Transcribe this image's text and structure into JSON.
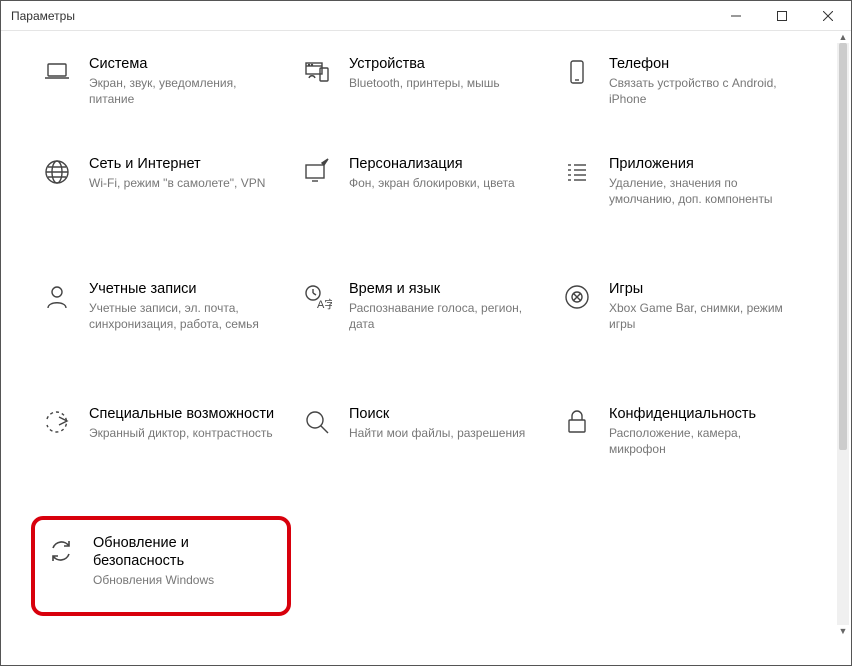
{
  "window": {
    "title": "Параметры"
  },
  "tiles": [
    {
      "title": "Система",
      "subtitle": "Экран, звук, уведомления, питание"
    },
    {
      "title": "Устройства",
      "subtitle": "Bluetooth, принтеры, мышь"
    },
    {
      "title": "Телефон",
      "subtitle": "Связать устройство с Android, iPhone"
    },
    {
      "title": "Сеть и Интернет",
      "subtitle": "Wi-Fi, режим \"в самолете\", VPN"
    },
    {
      "title": "Персонализация",
      "subtitle": "Фон, экран блокировки, цвета"
    },
    {
      "title": "Приложения",
      "subtitle": "Удаление, значения по умолчанию, доп. компоненты"
    },
    {
      "title": "Учетные записи",
      "subtitle": "Учетные записи, эл. почта, синхронизация, работа, семья"
    },
    {
      "title": "Время и язык",
      "subtitle": "Распознавание голоса, регион, дата"
    },
    {
      "title": "Игры",
      "subtitle": "Xbox Game Bar, снимки, режим игры"
    },
    {
      "title": "Специальные возможности",
      "subtitle": "Экранный диктор, контрастность"
    },
    {
      "title": "Поиск",
      "subtitle": "Найти мои файлы, разрешения"
    },
    {
      "title": "Конфиденциальность",
      "subtitle": "Расположение, камера, микрофон"
    },
    {
      "title": "Обновление и безопасность",
      "subtitle": "Обновления Windows"
    }
  ]
}
